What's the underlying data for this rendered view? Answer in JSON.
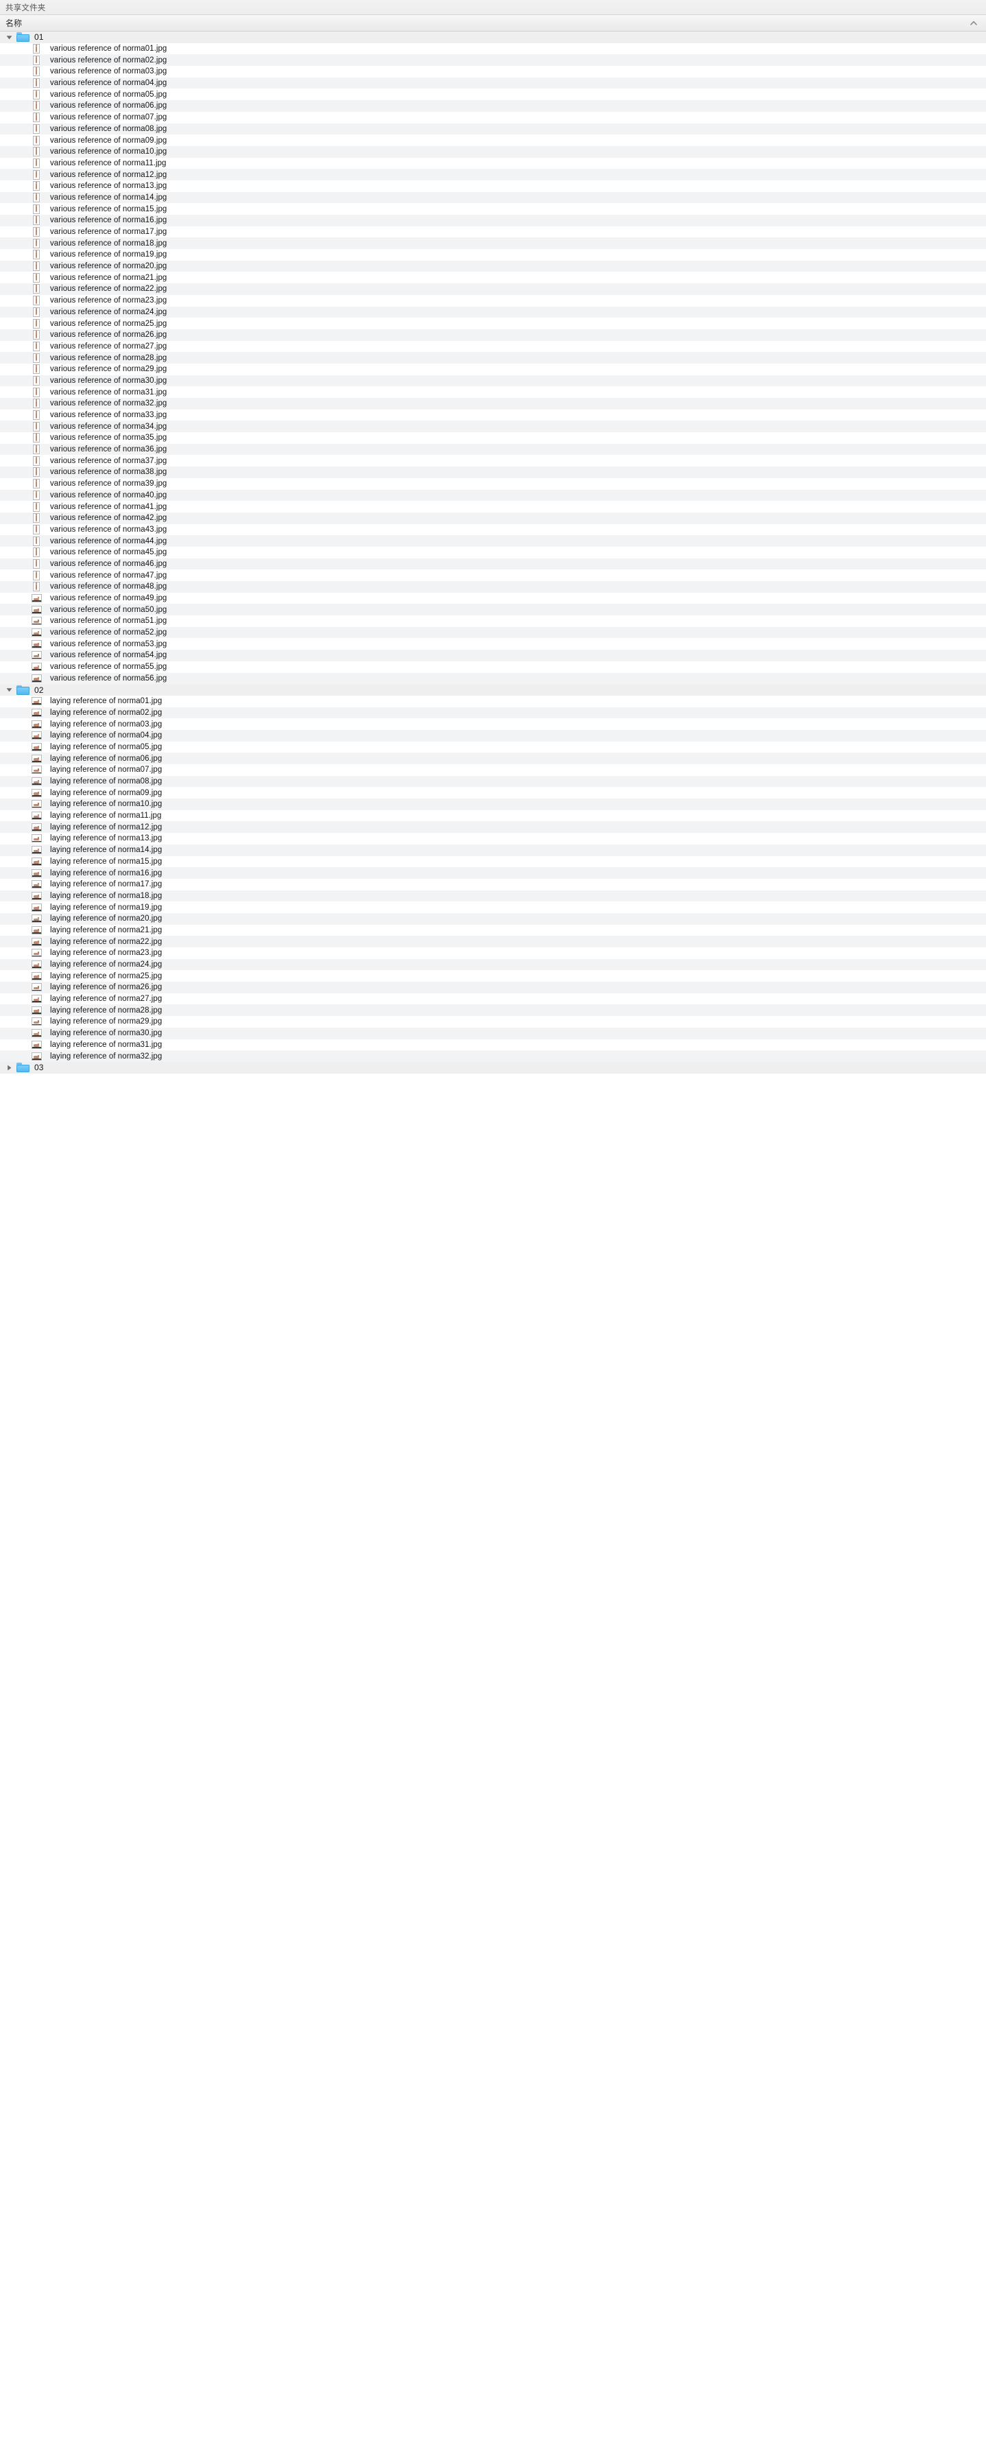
{
  "window": {
    "title": "共享文件夹"
  },
  "column_header": {
    "name_label": "名称",
    "sort_icon": "chevron-up-icon",
    "sort_direction": "ascending"
  },
  "colors": {
    "folder_blue": "#54b8f0",
    "row_stripe": "#f2f3f4",
    "row_base": "#ffffff",
    "header_bg": "#efefef",
    "text": "#131313",
    "title_text": "#555555"
  },
  "tree": [
    {
      "type": "folder",
      "name": "01",
      "expanded": true,
      "icon": "folder-icon",
      "disclosure_icon": "triangle-down-icon",
      "children": [
        {
          "name": "various reference of norma01.jpg",
          "thumb": "portrait"
        },
        {
          "name": "various reference of norma02.jpg",
          "thumb": "portrait"
        },
        {
          "name": "various reference of norma03.jpg",
          "thumb": "portrait"
        },
        {
          "name": "various reference of norma04.jpg",
          "thumb": "portrait"
        },
        {
          "name": "various reference of norma05.jpg",
          "thumb": "portrait"
        },
        {
          "name": "various reference of norma06.jpg",
          "thumb": "portrait"
        },
        {
          "name": "various reference of norma07.jpg",
          "thumb": "portrait"
        },
        {
          "name": "various reference of norma08.jpg",
          "thumb": "portrait"
        },
        {
          "name": "various reference of norma09.jpg",
          "thumb": "portrait"
        },
        {
          "name": "various reference of norma10.jpg",
          "thumb": "portrait"
        },
        {
          "name": "various reference of norma11.jpg",
          "thumb": "portrait"
        },
        {
          "name": "various reference of norma12.jpg",
          "thumb": "portrait"
        },
        {
          "name": "various reference of norma13.jpg",
          "thumb": "portrait"
        },
        {
          "name": "various reference of norma14.jpg",
          "thumb": "portrait"
        },
        {
          "name": "various reference of norma15.jpg",
          "thumb": "portrait"
        },
        {
          "name": "various reference of norma16.jpg",
          "thumb": "portrait"
        },
        {
          "name": "various reference of norma17.jpg",
          "thumb": "portrait"
        },
        {
          "name": "various reference of norma18.jpg",
          "thumb": "portrait"
        },
        {
          "name": "various reference of norma19.jpg",
          "thumb": "portrait"
        },
        {
          "name": "various reference of norma20.jpg",
          "thumb": "portrait"
        },
        {
          "name": "various reference of norma21.jpg",
          "thumb": "portrait"
        },
        {
          "name": "various reference of norma22.jpg",
          "thumb": "portrait"
        },
        {
          "name": "various reference of norma23.jpg",
          "thumb": "portrait"
        },
        {
          "name": "various reference of norma24.jpg",
          "thumb": "portrait"
        },
        {
          "name": "various reference of norma25.jpg",
          "thumb": "portrait"
        },
        {
          "name": "various reference of norma26.jpg",
          "thumb": "portrait"
        },
        {
          "name": "various reference of norma27.jpg",
          "thumb": "portrait"
        },
        {
          "name": "various reference of norma28.jpg",
          "thumb": "portrait"
        },
        {
          "name": "various reference of norma29.jpg",
          "thumb": "portrait"
        },
        {
          "name": "various reference of norma30.jpg",
          "thumb": "portrait"
        },
        {
          "name": "various reference of norma31.jpg",
          "thumb": "portrait"
        },
        {
          "name": "various reference of norma32.jpg",
          "thumb": "portrait"
        },
        {
          "name": "various reference of norma33.jpg",
          "thumb": "portrait"
        },
        {
          "name": "various reference of norma34.jpg",
          "thumb": "portrait"
        },
        {
          "name": "various reference of norma35.jpg",
          "thumb": "portrait"
        },
        {
          "name": "various reference of norma36.jpg",
          "thumb": "portrait"
        },
        {
          "name": "various reference of norma37.jpg",
          "thumb": "portrait"
        },
        {
          "name": "various reference of norma38.jpg",
          "thumb": "portrait"
        },
        {
          "name": "various reference of norma39.jpg",
          "thumb": "portrait"
        },
        {
          "name": "various reference of norma40.jpg",
          "thumb": "portrait"
        },
        {
          "name": "various reference of norma41.jpg",
          "thumb": "portrait"
        },
        {
          "name": "various reference of norma42.jpg",
          "thumb": "portrait"
        },
        {
          "name": "various reference of norma43.jpg",
          "thumb": "portrait"
        },
        {
          "name": "various reference of norma44.jpg",
          "thumb": "portrait"
        },
        {
          "name": "various reference of norma45.jpg",
          "thumb": "portrait"
        },
        {
          "name": "various reference of norma46.jpg",
          "thumb": "portrait"
        },
        {
          "name": "various reference of norma47.jpg",
          "thumb": "portrait"
        },
        {
          "name": "various reference of norma48.jpg",
          "thumb": "portrait"
        },
        {
          "name": "various reference of norma49.jpg",
          "thumb": "landscape"
        },
        {
          "name": "various reference of norma50.jpg",
          "thumb": "landscape"
        },
        {
          "name": "various reference of norma51.jpg",
          "thumb": "landscape"
        },
        {
          "name": "various reference of norma52.jpg",
          "thumb": "landscape"
        },
        {
          "name": "various reference of norma53.jpg",
          "thumb": "landscape"
        },
        {
          "name": "various reference of norma54.jpg",
          "thumb": "landscape"
        },
        {
          "name": "various reference of norma55.jpg",
          "thumb": "landscape"
        },
        {
          "name": "various reference of norma56.jpg",
          "thumb": "landscape"
        }
      ]
    },
    {
      "type": "folder",
      "name": "02",
      "expanded": true,
      "icon": "folder-icon",
      "disclosure_icon": "triangle-down-icon",
      "children": [
        {
          "name": "laying reference of norma01.jpg",
          "thumb": "landscape"
        },
        {
          "name": "laying reference of norma02.jpg",
          "thumb": "landscape"
        },
        {
          "name": "laying reference of norma03.jpg",
          "thumb": "landscape"
        },
        {
          "name": "laying reference of norma04.jpg",
          "thumb": "landscape"
        },
        {
          "name": "laying reference of norma05.jpg",
          "thumb": "landscape"
        },
        {
          "name": "laying reference of norma06.jpg",
          "thumb": "landscape"
        },
        {
          "name": "laying reference of norma07.jpg",
          "thumb": "landscape"
        },
        {
          "name": "laying reference of norma08.jpg",
          "thumb": "landscape"
        },
        {
          "name": "laying reference of norma09.jpg",
          "thumb": "landscape"
        },
        {
          "name": "laying reference of norma10.jpg",
          "thumb": "landscape"
        },
        {
          "name": "laying reference of norma11.jpg",
          "thumb": "landscape"
        },
        {
          "name": "laying reference of norma12.jpg",
          "thumb": "landscape"
        },
        {
          "name": "laying reference of norma13.jpg",
          "thumb": "landscape"
        },
        {
          "name": "laying reference of norma14.jpg",
          "thumb": "landscape"
        },
        {
          "name": "laying reference of norma15.jpg",
          "thumb": "landscape"
        },
        {
          "name": "laying reference of norma16.jpg",
          "thumb": "landscape"
        },
        {
          "name": "laying reference of norma17.jpg",
          "thumb": "landscape"
        },
        {
          "name": "laying reference of norma18.jpg",
          "thumb": "landscape"
        },
        {
          "name": "laying reference of norma19.jpg",
          "thumb": "landscape"
        },
        {
          "name": "laying reference of norma20.jpg",
          "thumb": "landscape"
        },
        {
          "name": "laying reference of norma21.jpg",
          "thumb": "landscape"
        },
        {
          "name": "laying reference of norma22.jpg",
          "thumb": "landscape"
        },
        {
          "name": "laying reference of norma23.jpg",
          "thumb": "landscape"
        },
        {
          "name": "laying reference of norma24.jpg",
          "thumb": "landscape"
        },
        {
          "name": "laying reference of norma25.jpg",
          "thumb": "landscape"
        },
        {
          "name": "laying reference of norma26.jpg",
          "thumb": "landscape"
        },
        {
          "name": "laying reference of norma27.jpg",
          "thumb": "landscape"
        },
        {
          "name": "laying reference of norma28.jpg",
          "thumb": "landscape"
        },
        {
          "name": "laying reference of norma29.jpg",
          "thumb": "landscape"
        },
        {
          "name": "laying reference of norma30.jpg",
          "thumb": "landscape"
        },
        {
          "name": "laying reference of norma31.jpg",
          "thumb": "landscape"
        },
        {
          "name": "laying reference of norma32.jpg",
          "thumb": "landscape"
        }
      ]
    },
    {
      "type": "folder",
      "name": "03",
      "expanded": false,
      "icon": "folder-icon",
      "disclosure_icon": "triangle-right-icon",
      "children": []
    }
  ]
}
